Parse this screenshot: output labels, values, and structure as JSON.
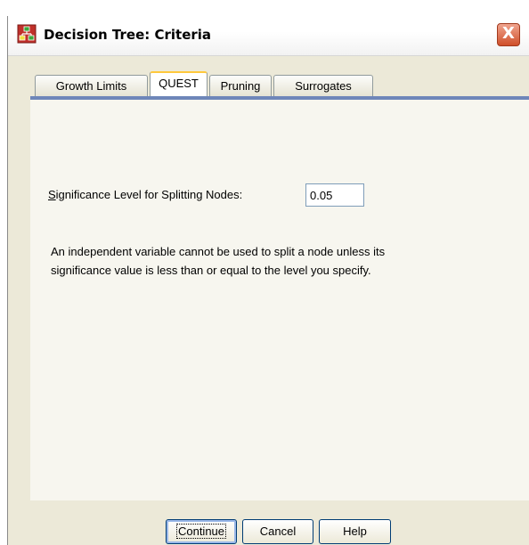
{
  "window": {
    "title": "Decision Tree: Criteria",
    "close_glyph": "X",
    "icon": "decision-tree-app-icon"
  },
  "tabs": [
    {
      "label": "Growth Limits",
      "active": false
    },
    {
      "label": "QUEST",
      "active": true
    },
    {
      "label": "Pruning",
      "active": false
    },
    {
      "label": "Surrogates",
      "active": false
    }
  ],
  "quest": {
    "significance_label_accel": "S",
    "significance_label_rest": "ignificance Level for Splitting Nodes:",
    "significance_value": "0.05",
    "info_line1": "An independent variable cannot be used to split a node unless its",
    "info_line2": "significance value is less than or equal to the level you specify."
  },
  "buttons": {
    "continue": "Continue",
    "cancel": "Cancel",
    "help": "Help"
  },
  "colors": {
    "tab_underline": "#6e86b9",
    "close_button": "#cf4f2a",
    "active_tab_accent": "#ffc83c"
  }
}
